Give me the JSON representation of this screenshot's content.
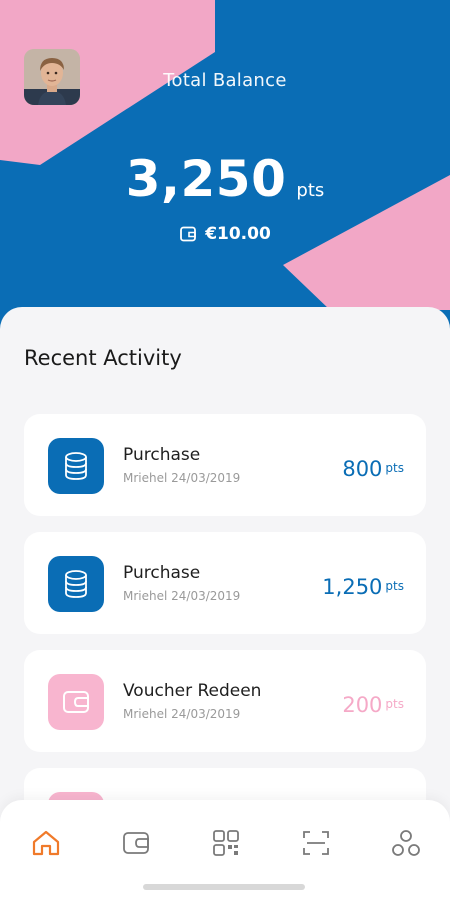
{
  "header": {
    "balance_label": "Total Balance",
    "balance_value": "3,250",
    "balance_unit": "pts",
    "cash_value": "€10.00"
  },
  "activity": {
    "title": "Recent Activity",
    "items": [
      {
        "title": "Purchase",
        "subtitle": "Mriehel 24/03/2019",
        "points": "800",
        "unit": "pts",
        "icon": "coins-icon",
        "color": "#0a6db5"
      },
      {
        "title": "Purchase",
        "subtitle": "Mriehel 24/03/2019",
        "points": "1,250",
        "unit": "pts",
        "icon": "coins-icon",
        "color": "#0a6db5"
      },
      {
        "title": "Voucher Redeen",
        "subtitle": "Mriehel 24/03/2019",
        "points": "200",
        "unit": "pts",
        "icon": "wallet-icon",
        "color": "#f5a9c7"
      }
    ]
  },
  "nav": {
    "items": [
      "home-icon",
      "wallet-icon",
      "qr-code-icon",
      "scan-icon",
      "more-icon"
    ],
    "active": "home-icon"
  },
  "colors": {
    "primary": "#0a6db5",
    "accent_pink": "#f2a7c6",
    "active_nav": "#f07a2a"
  }
}
